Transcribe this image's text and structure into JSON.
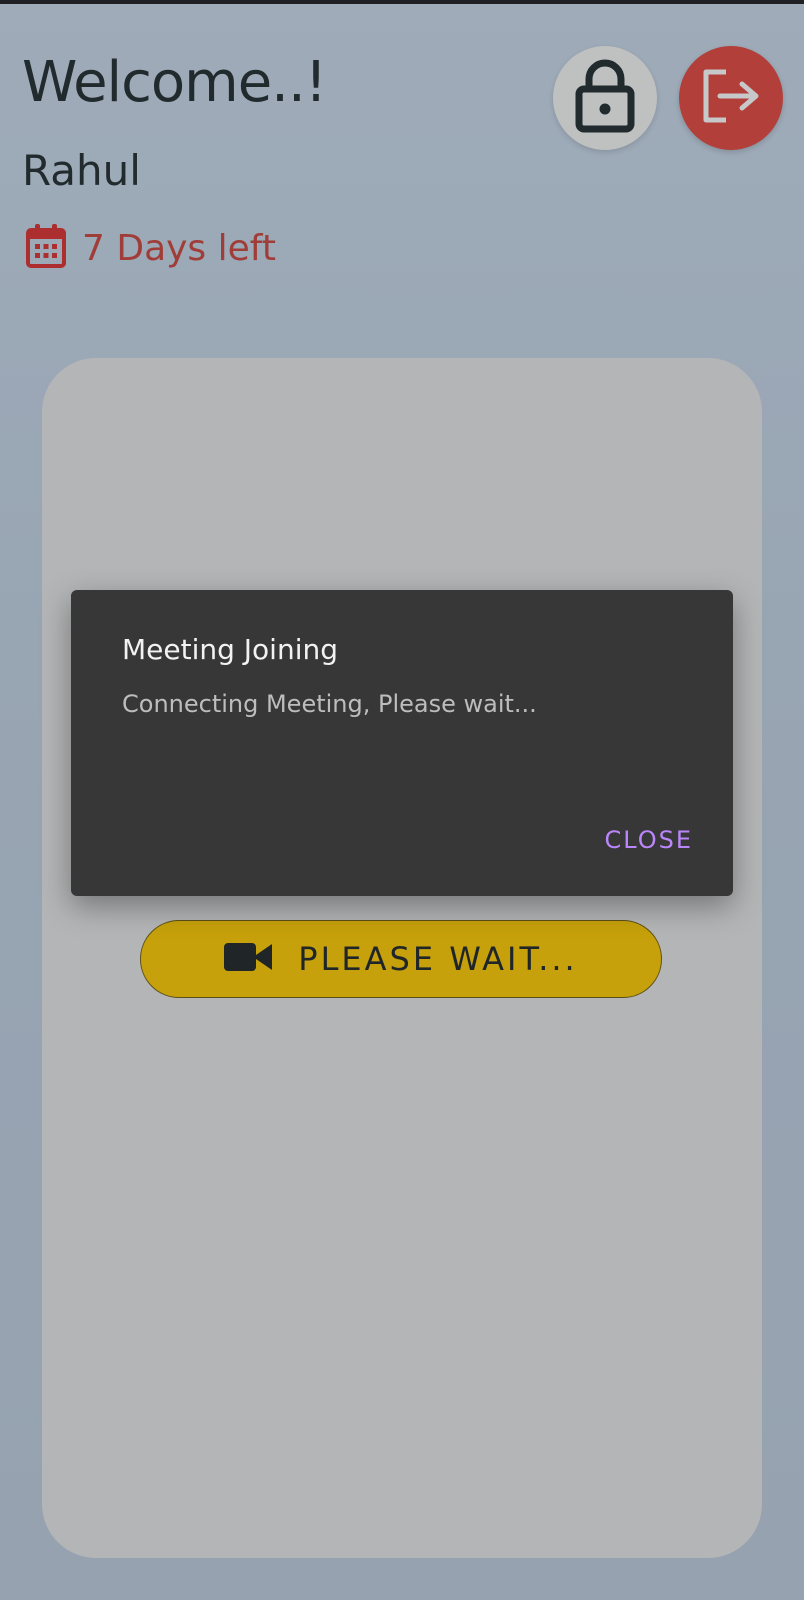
{
  "header": {
    "welcome": "Welcome..!",
    "username": "Rahul",
    "days_left": "7 Days left"
  },
  "actions": {
    "lock_icon": "lock-icon",
    "logout_icon": "logout-icon"
  },
  "main": {
    "wait_button_label": "PLEASE WAIT...",
    "wait_button_icon": "video-camera-icon"
  },
  "dialog": {
    "title": "Meeting Joining",
    "message": "Connecting Meeting, Please wait...",
    "close_label": "CLOSE"
  },
  "colors": {
    "accent_red": "#d9453d",
    "days_text": "#c3423c",
    "button_yellow": "#f2c200",
    "dialog_bg": "#373737",
    "dialog_action": "#bb86fc"
  }
}
